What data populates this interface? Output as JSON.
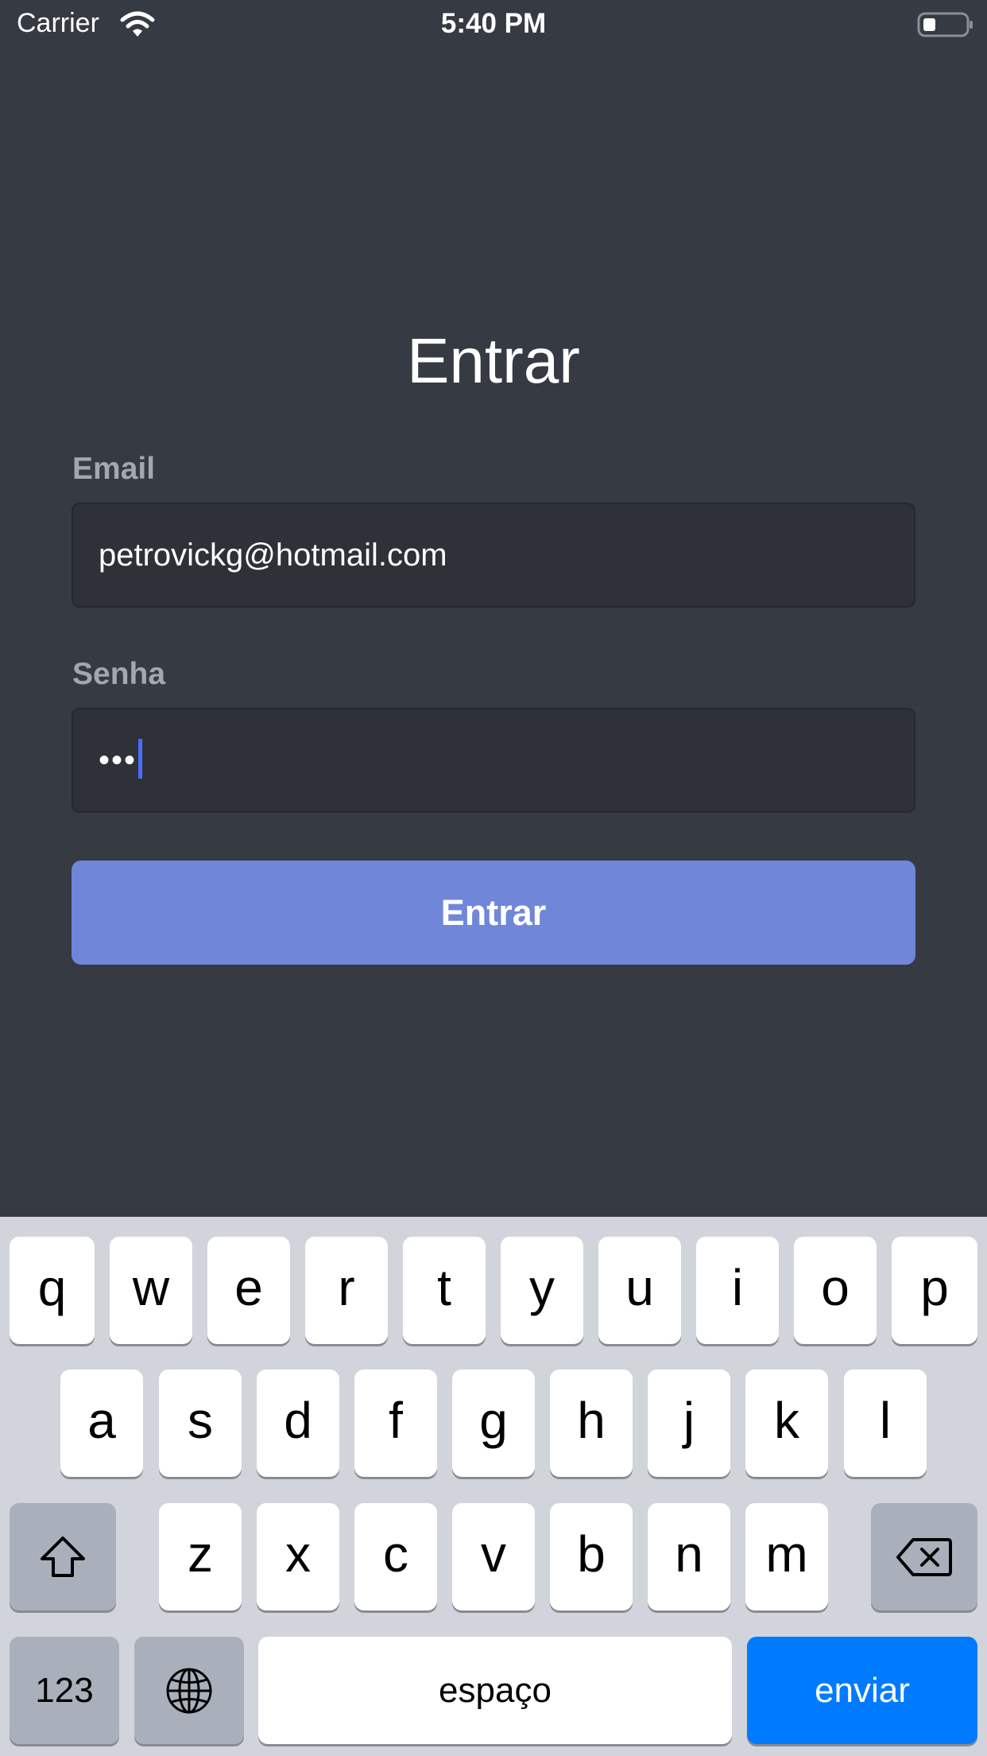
{
  "status_bar": {
    "carrier": "Carrier",
    "time": "5:40 PM"
  },
  "login": {
    "title": "Entrar",
    "email_label": "Email",
    "email_value": "petrovickg@hotmail.com",
    "password_label": "Senha",
    "password_value": "•••",
    "submit_label": "Entrar"
  },
  "keyboard": {
    "row1": [
      "q",
      "w",
      "e",
      "r",
      "t",
      "y",
      "u",
      "i",
      "o",
      "p"
    ],
    "row2": [
      "a",
      "s",
      "d",
      "f",
      "g",
      "h",
      "j",
      "k",
      "l"
    ],
    "row3": [
      "z",
      "x",
      "c",
      "v",
      "b",
      "n",
      "m"
    ],
    "numbers_label": "123",
    "space_label": "espaço",
    "return_label": "enviar",
    "icons": [
      "shift-icon",
      "backspace-icon",
      "globe-icon"
    ]
  },
  "colors": {
    "background": "#353a43",
    "field_background": "#2e3138",
    "button": "#7086d9",
    "keyboard_background": "#d1d4da",
    "return_key": "#007aff",
    "caret": "#4a6cf7"
  }
}
